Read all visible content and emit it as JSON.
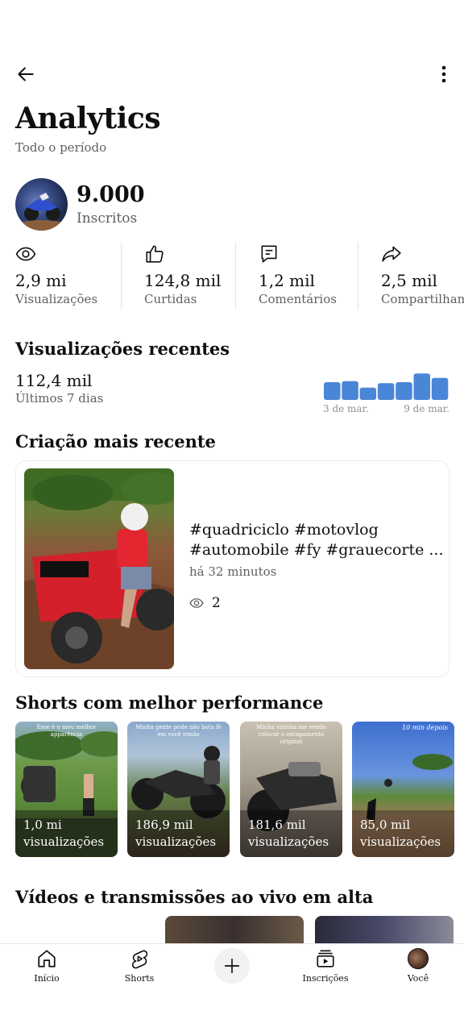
{
  "header": {
    "title": "Analytics",
    "subtitle": "Todo o período"
  },
  "channel": {
    "subscribers_count": "9.000",
    "subscribers_label": "Inscritos"
  },
  "stats": [
    {
      "icon": "eye-icon",
      "value": "2,9 mi",
      "label": "Visualizações"
    },
    {
      "icon": "thumbs-up-icon",
      "value": "124,8 mil",
      "label": "Curtidas"
    },
    {
      "icon": "comment-icon",
      "value": "1,2 mil",
      "label": "Comentários"
    },
    {
      "icon": "share-icon",
      "value": "2,5 mil",
      "label": "Compartilhamentos"
    }
  ],
  "recent_views": {
    "title": "Visualizações recentes",
    "value": "112,4 mil",
    "period": "Últimos 7 dias",
    "chart_start_label": "3 de mar.",
    "chart_end_label": "9 de mar.",
    "bar_color": "#4a86d8",
    "chart_data": {
      "type": "bar",
      "categories": [
        "3 de mar.",
        "",
        "",
        "",
        "",
        "",
        "9 de mar."
      ],
      "values": [
        0.55,
        0.58,
        0.38,
        0.52,
        0.55,
        0.82,
        0.68
      ]
    }
  },
  "latest_creation": {
    "title": "Criação mais recente",
    "video_title": "#quadriciclo #motovlog #automobile #fy #grauecorte ...",
    "time": "há 32 minutos",
    "views": "2"
  },
  "top_shorts": {
    "title": "Shorts com melhor performance",
    "items": [
      {
        "overlay": "Esse é o meu melhor apparência",
        "views": "1,0 mi",
        "views_label": "visualizações"
      },
      {
        "overlay": "Minha gente pode não bota fé em você irmão",
        "views": "186,9 mil",
        "views_label": "visualizações"
      },
      {
        "overlay": "Minha vizinha me vendo colocar o escapamento original",
        "views": "181,6 mil",
        "views_label": "visualizações"
      },
      {
        "overlay": "10 min depois",
        "views": "85,0 mil",
        "views_label": "visualizações"
      }
    ]
  },
  "trending": {
    "title": "Vídeos e transmissões ao vivo em alta"
  },
  "navbar": {
    "items": [
      {
        "label": "Início",
        "icon": "home-icon"
      },
      {
        "label": "Shorts",
        "icon": "shorts-icon"
      },
      {
        "label": "",
        "icon": "plus-icon"
      },
      {
        "label": "Inscrições",
        "icon": "subscriptions-icon"
      },
      {
        "label": "Você",
        "icon": "avatar-icon"
      }
    ]
  }
}
